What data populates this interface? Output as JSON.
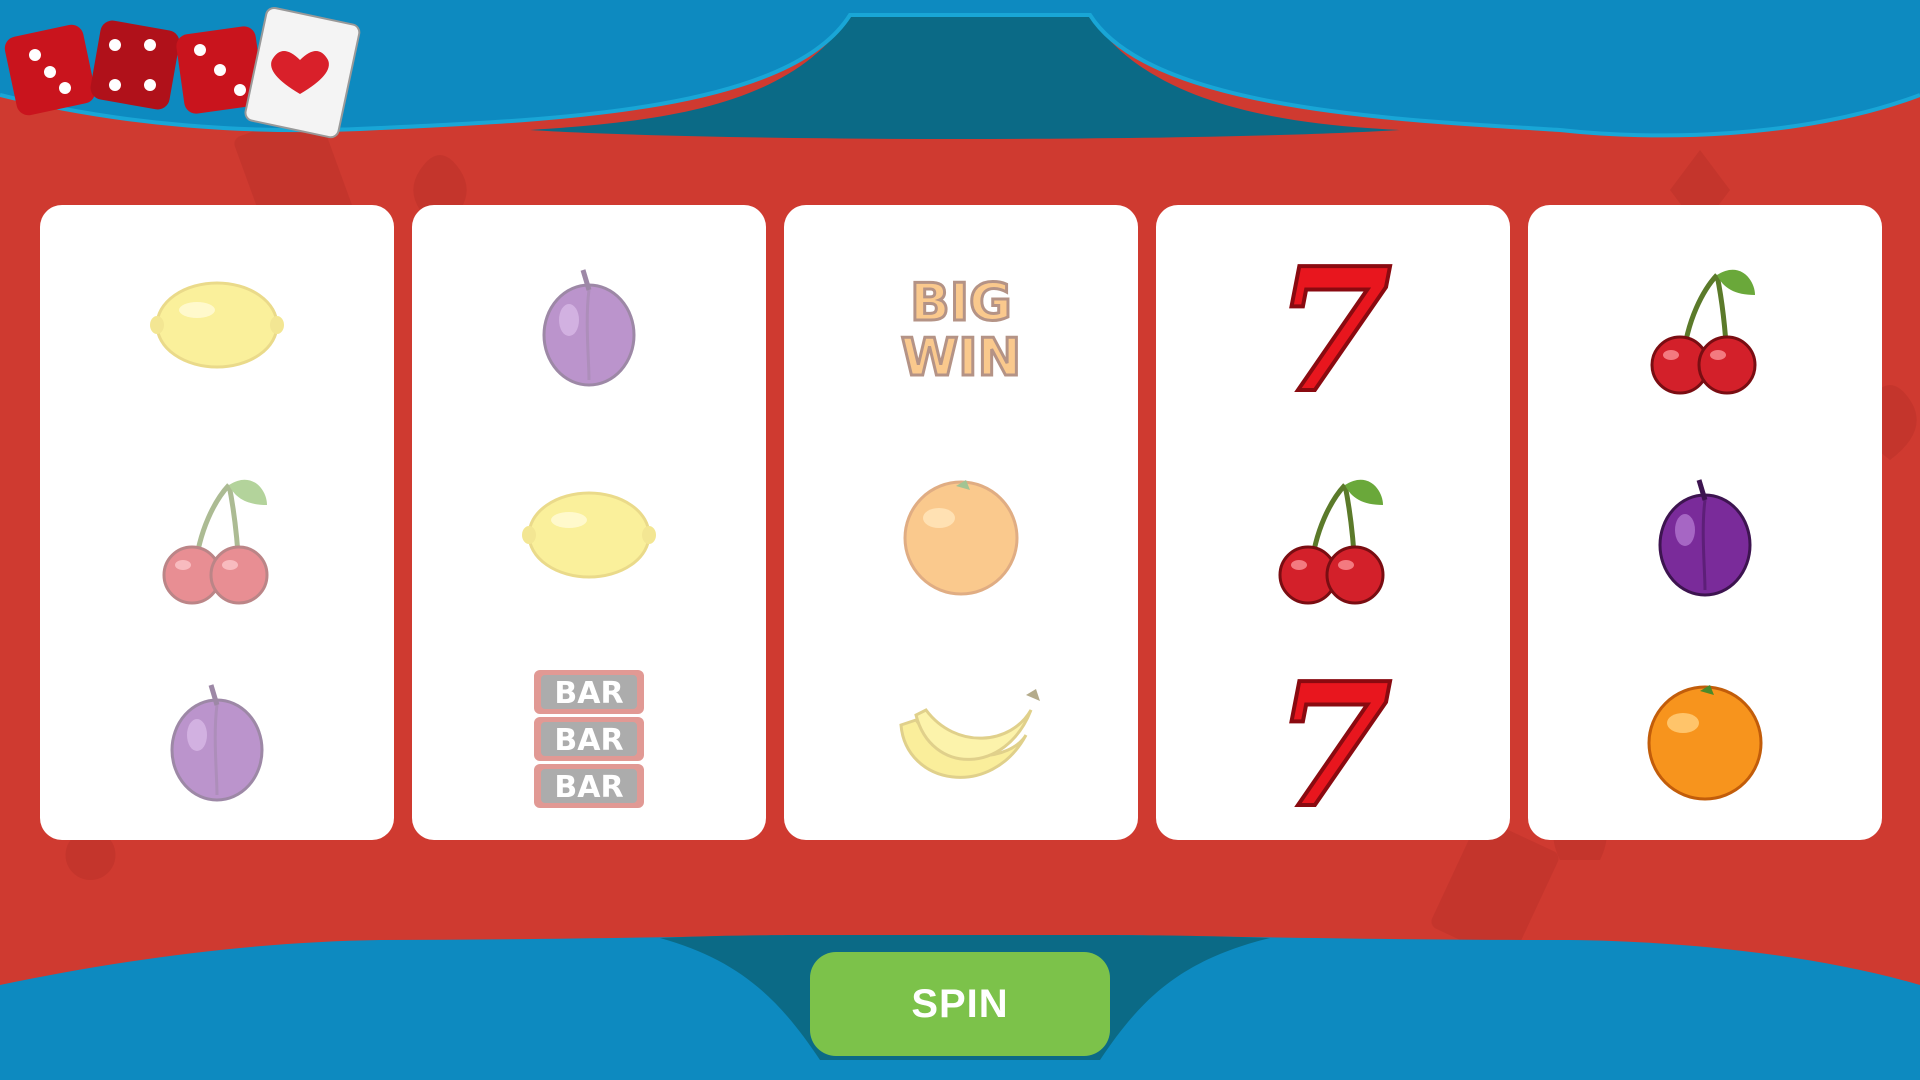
{
  "game": "slot-machine",
  "colors": {
    "felt": "#cf3a30",
    "banner": "#0d8ac0",
    "banner_dark": "#0b6a86",
    "reel_bg": "#ffffff",
    "spin_button": "#7cc24a"
  },
  "reels": [
    {
      "symbols": [
        "lemon",
        "cherry",
        "plum"
      ],
      "faded": true
    },
    {
      "symbols": [
        "plum",
        "lemon",
        "triple-bar"
      ],
      "faded": true
    },
    {
      "symbols": [
        "big-win",
        "orange",
        "banana"
      ],
      "faded": true
    },
    {
      "symbols": [
        "seven",
        "cherry",
        "seven"
      ],
      "faded": false
    },
    {
      "symbols": [
        "cherry",
        "plum",
        "orange"
      ],
      "faded": false
    }
  ],
  "symbol_text": {
    "bar": "BAR",
    "big": "BIG",
    "win": "WIN",
    "seven": "7"
  },
  "controls": {
    "spin_label": "SPIN"
  },
  "decoration": [
    "dice-icon",
    "dice-icon",
    "dice-icon",
    "playing-card-heart-icon"
  ]
}
